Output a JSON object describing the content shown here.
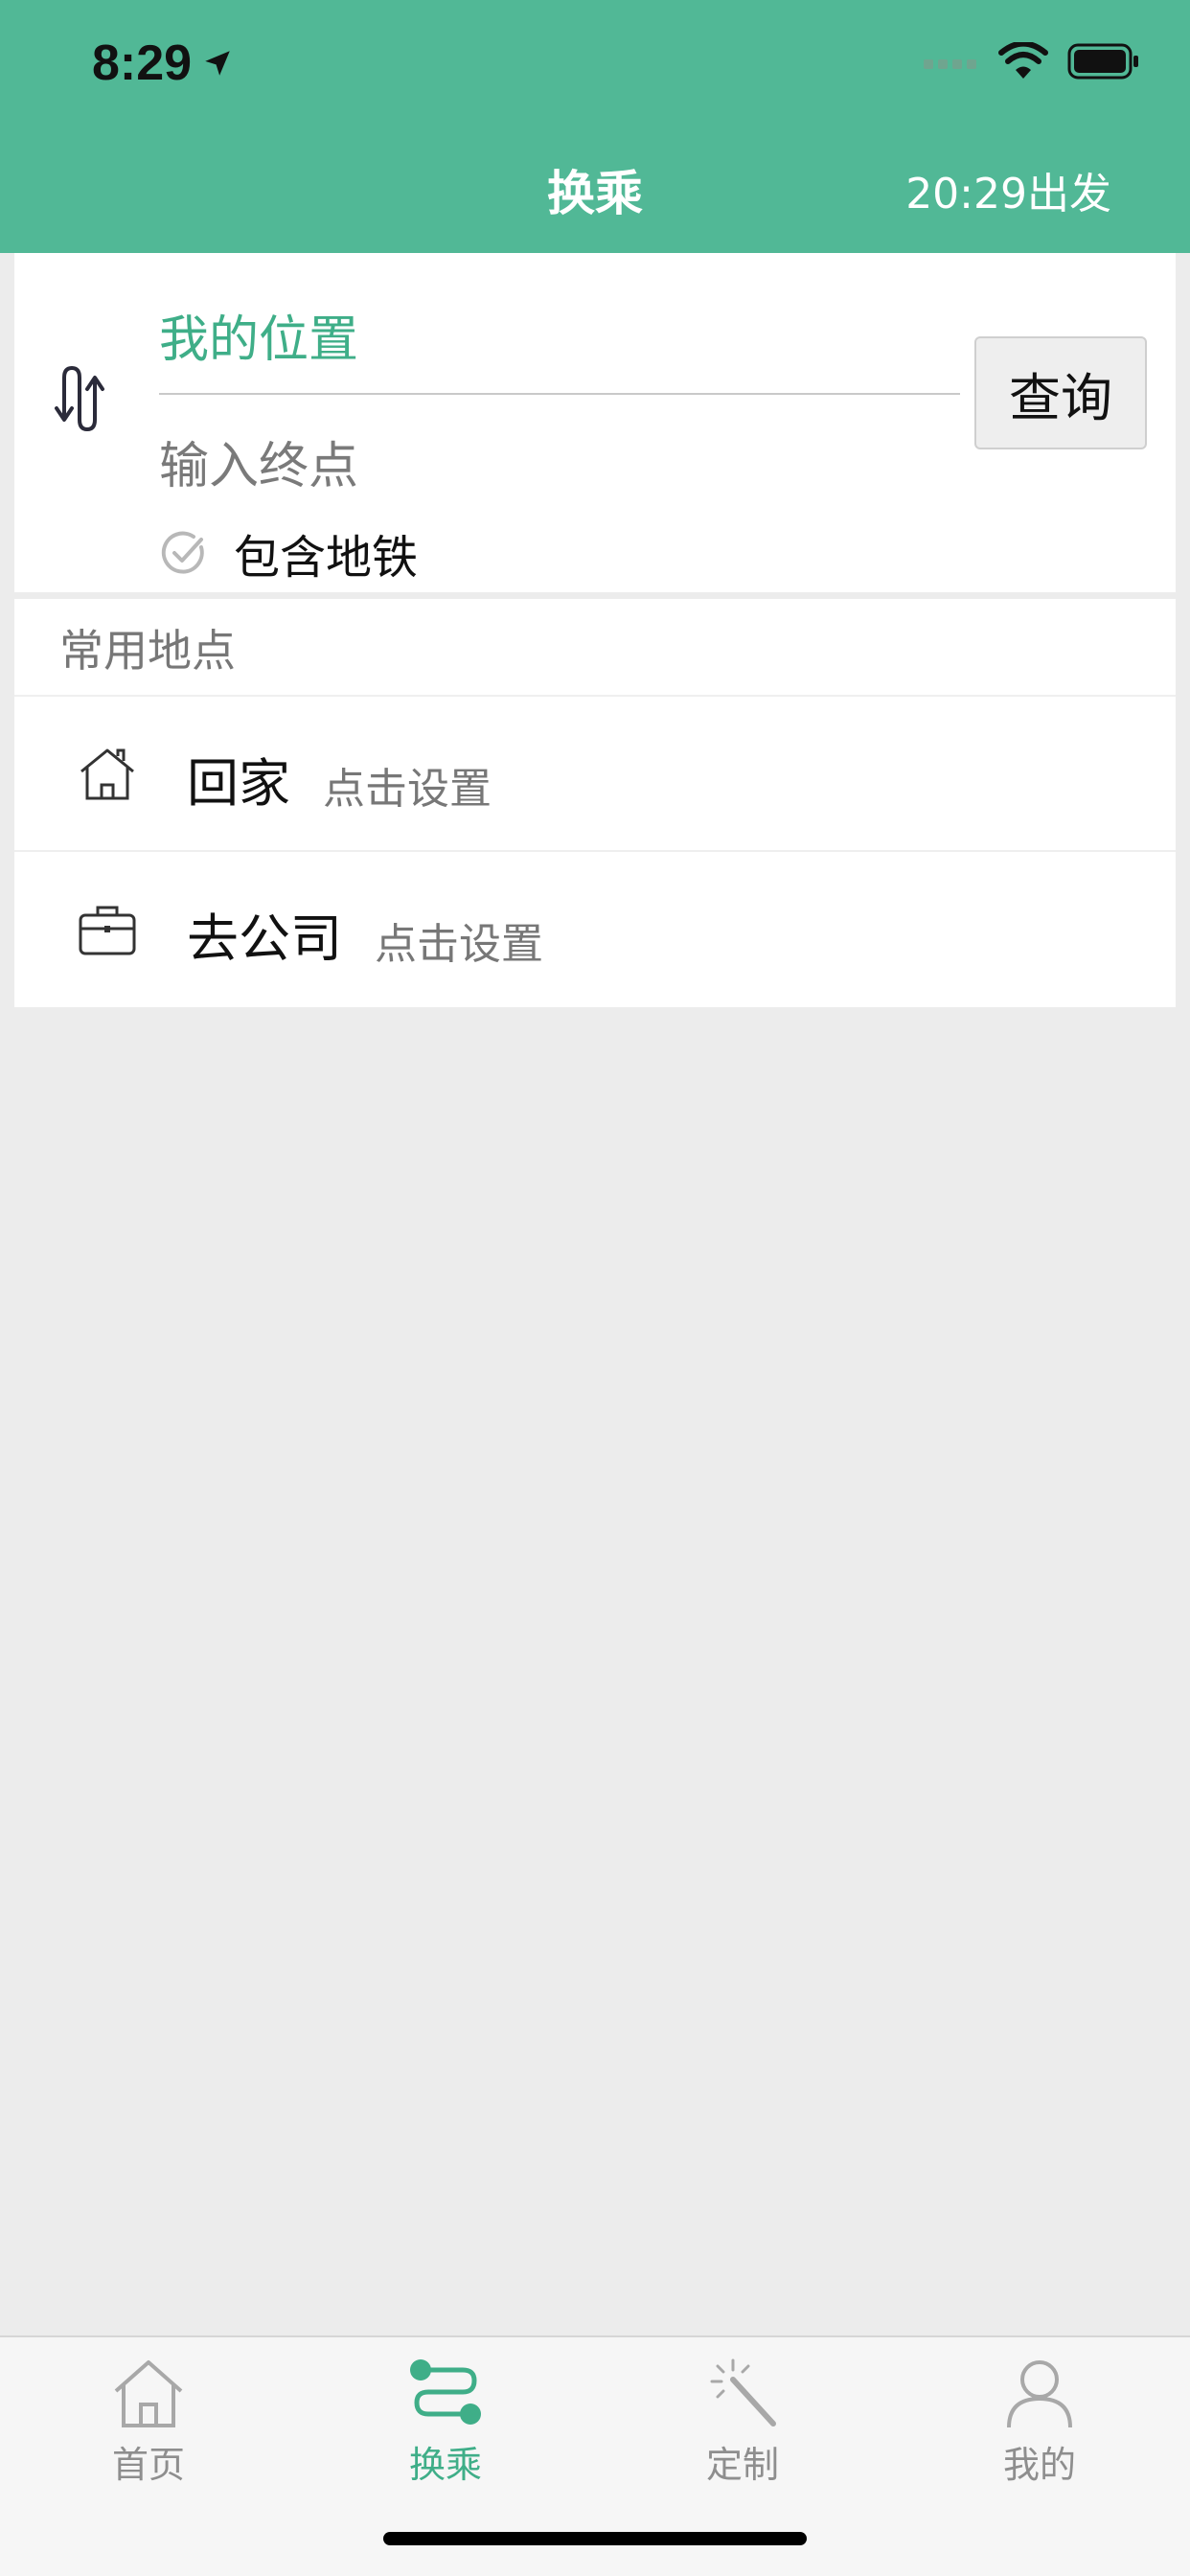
{
  "status_bar": {
    "time": "8:29"
  },
  "nav": {
    "title": "换乘",
    "depart_time": "20:29出发"
  },
  "search": {
    "origin": "我的位置",
    "destination_placeholder": "输入终点",
    "subway_label": "包含地铁",
    "subway_checked": true,
    "query_button": "查询"
  },
  "common_places": {
    "title": "常用地点",
    "items": [
      {
        "name": "回家",
        "hint": "点击设置",
        "icon": "house-icon"
      },
      {
        "name": "去公司",
        "hint": "点击设置",
        "icon": "briefcase-icon"
      }
    ]
  },
  "tabs": [
    {
      "label": "首页",
      "icon": "home-icon",
      "active": false
    },
    {
      "label": "换乘",
      "icon": "route-icon",
      "active": true
    },
    {
      "label": "定制",
      "icon": "magic-wand-icon",
      "active": false
    },
    {
      "label": "我的",
      "icon": "user-icon",
      "active": false
    }
  ],
  "colors": {
    "brand": "#51b896",
    "accent": "#3fae88"
  }
}
